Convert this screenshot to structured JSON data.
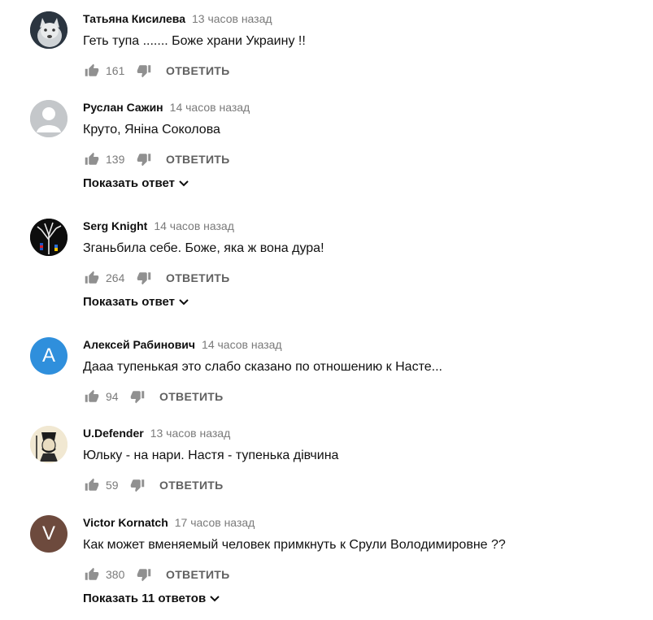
{
  "comments": [
    {
      "author": "Татьяна Кисилева",
      "time": "13 часов назад",
      "text": "Геть  тупа ....... Боже  храни Украину !!",
      "likes": "161",
      "reply_label": "ОТВЕТИТЬ",
      "avatar": "wolf-photo-avatar"
    },
    {
      "author": "Руслан Сажин",
      "time": "14 часов назад",
      "text": "Круто, Яніна Соколова",
      "likes": "139",
      "reply_label": "ОТВЕТИТЬ",
      "show_replies": "Показать ответ",
      "avatar": "default-user-avatar"
    },
    {
      "author": "Serg Knight",
      "time": "14 часов назад",
      "text": "Зганьбила  себе. Боже, яка ж вона дура!",
      "likes": "264",
      "reply_label": "ОТВЕТИТЬ",
      "show_replies": "Показать ответ",
      "avatar": "tree-image-avatar"
    },
    {
      "author": "Алексей Рабинович",
      "time": "14 часов назад",
      "text": "Дааа тупенькая это слабо сказано по отношению к Насте...",
      "likes": "94",
      "reply_label": "ОТВЕТИТЬ",
      "avatar_letter": "А",
      "avatar_color": "#2f8fdc"
    },
    {
      "author": "U.Defender",
      "time": "13 часов назад",
      "text": "Юльку - на нари. Настя - тупенька дівчина",
      "likes": "59",
      "reply_label": "ОТВЕТИТЬ",
      "avatar": "cossack-drawing-avatar"
    },
    {
      "author": "Victor Kornatch",
      "time": "17 часов назад",
      "text": "Как может вменяемый человек  примкнуть к Срули Володимировне ??",
      "likes": "380",
      "reply_label": "ОТВЕТИТЬ",
      "show_replies": "Показать 11 ответов",
      "avatar_letter": "V",
      "avatar_color": "#6d4a3d"
    }
  ]
}
